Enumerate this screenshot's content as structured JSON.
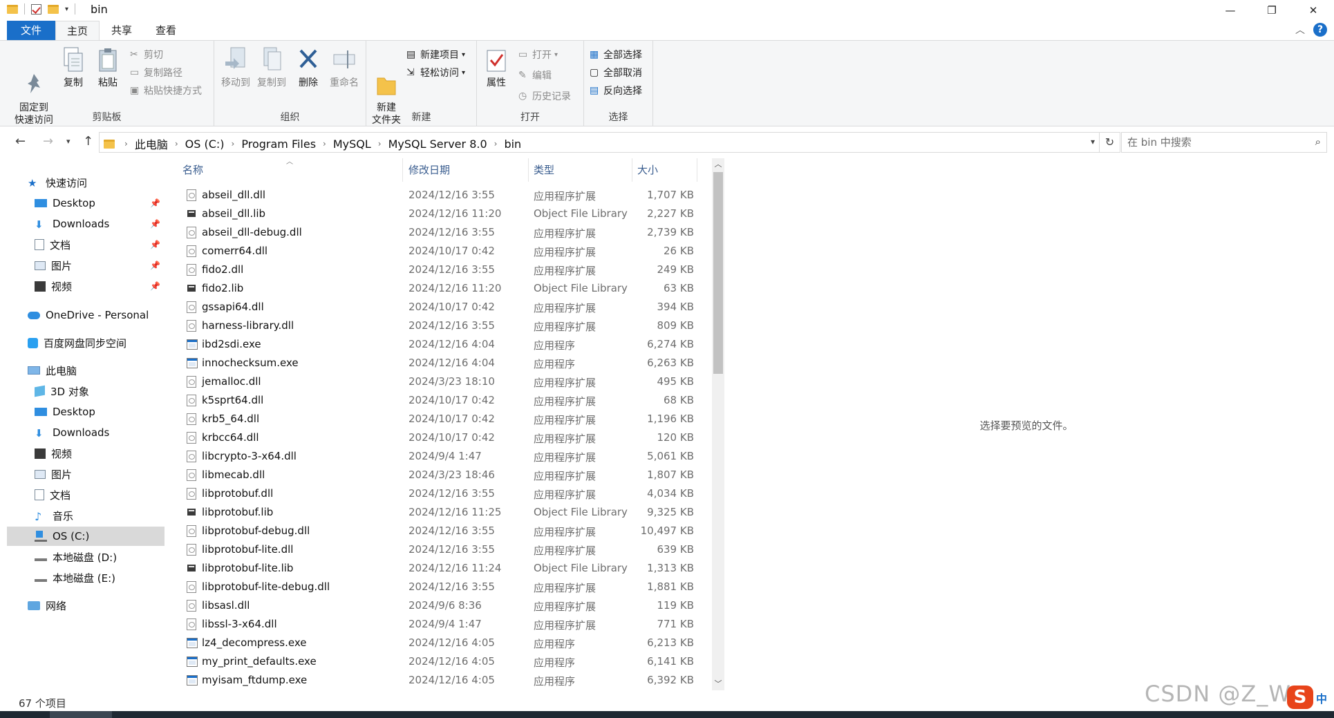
{
  "window": {
    "title": "bin",
    "controls": {
      "minimize": "—",
      "maximize": "❐",
      "close": "✕"
    }
  },
  "ribbon_tabs": [
    {
      "label": "文件"
    },
    {
      "label": "主页"
    },
    {
      "label": "共享"
    },
    {
      "label": "查看"
    }
  ],
  "ribbon": {
    "clipboard": {
      "label": "剪贴板",
      "pin": "固定到\n快速访问",
      "copy": "复制",
      "paste": "粘贴",
      "cut": "剪切",
      "copy_path": "复制路径",
      "paste_shortcut": "粘贴快捷方式"
    },
    "organize": {
      "label": "组织",
      "move_to": "移动到",
      "copy_to": "复制到",
      "delete": "删除",
      "rename": "重命名"
    },
    "new": {
      "label": "新建",
      "new_folder": "新建\n文件夹",
      "new_item": "新建项目",
      "easy_access": "轻松访问"
    },
    "open": {
      "label": "打开",
      "properties": "属性",
      "open": "打开",
      "edit": "编辑",
      "history": "历史记录"
    },
    "select": {
      "label": "选择",
      "select_all": "全部选择",
      "select_none": "全部取消",
      "invert": "反向选择"
    }
  },
  "address": {
    "crumbs": [
      "此电脑",
      "OS (C:)",
      "Program Files",
      "MySQL",
      "MySQL Server 8.0",
      "bin"
    ],
    "search_placeholder": "在 bin 中搜索"
  },
  "nav_pane": {
    "quick_access": "快速访问",
    "quick_items": [
      "Desktop",
      "Downloads",
      "文档",
      "图片",
      "视频"
    ],
    "onedrive": "OneDrive - Personal",
    "baidu": "百度网盘同步空间",
    "this_pc": "此电脑",
    "pc_items": [
      "3D 对象",
      "Desktop",
      "Downloads",
      "视频",
      "图片",
      "文档",
      "音乐",
      "OS (C:)",
      "本地磁盘 (D:)",
      "本地磁盘 (E:)"
    ],
    "network": "网络"
  },
  "columns": {
    "name": "名称",
    "date": "修改日期",
    "type": "类型",
    "size": "大小"
  },
  "files": [
    {
      "name": "abseil_dll.dll",
      "date": "2024/12/16 3:55",
      "type": "应用程序扩展",
      "size": "1,707 KB",
      "icon": "dll"
    },
    {
      "name": "abseil_dll.lib",
      "date": "2024/12/16 11:20",
      "type": "Object File Library",
      "size": "2,227 KB",
      "icon": "lib"
    },
    {
      "name": "abseil_dll-debug.dll",
      "date": "2024/12/16 3:55",
      "type": "应用程序扩展",
      "size": "2,739 KB",
      "icon": "dll"
    },
    {
      "name": "comerr64.dll",
      "date": "2024/10/17 0:42",
      "type": "应用程序扩展",
      "size": "26 KB",
      "icon": "dll"
    },
    {
      "name": "fido2.dll",
      "date": "2024/12/16 3:55",
      "type": "应用程序扩展",
      "size": "249 KB",
      "icon": "dll"
    },
    {
      "name": "fido2.lib",
      "date": "2024/12/16 11:20",
      "type": "Object File Library",
      "size": "63 KB",
      "icon": "lib"
    },
    {
      "name": "gssapi64.dll",
      "date": "2024/10/17 0:42",
      "type": "应用程序扩展",
      "size": "394 KB",
      "icon": "dll"
    },
    {
      "name": "harness-library.dll",
      "date": "2024/12/16 3:55",
      "type": "应用程序扩展",
      "size": "809 KB",
      "icon": "dll"
    },
    {
      "name": "ibd2sdi.exe",
      "date": "2024/12/16 4:04",
      "type": "应用程序",
      "size": "6,274 KB",
      "icon": "exe"
    },
    {
      "name": "innochecksum.exe",
      "date": "2024/12/16 4:04",
      "type": "应用程序",
      "size": "6,263 KB",
      "icon": "exe"
    },
    {
      "name": "jemalloc.dll",
      "date": "2024/3/23 18:10",
      "type": "应用程序扩展",
      "size": "495 KB",
      "icon": "dll"
    },
    {
      "name": "k5sprt64.dll",
      "date": "2024/10/17 0:42",
      "type": "应用程序扩展",
      "size": "68 KB",
      "icon": "dll"
    },
    {
      "name": "krb5_64.dll",
      "date": "2024/10/17 0:42",
      "type": "应用程序扩展",
      "size": "1,196 KB",
      "icon": "dll"
    },
    {
      "name": "krbcc64.dll",
      "date": "2024/10/17 0:42",
      "type": "应用程序扩展",
      "size": "120 KB",
      "icon": "dll"
    },
    {
      "name": "libcrypto-3-x64.dll",
      "date": "2024/9/4 1:47",
      "type": "应用程序扩展",
      "size": "5,061 KB",
      "icon": "dll"
    },
    {
      "name": "libmecab.dll",
      "date": "2024/3/23 18:46",
      "type": "应用程序扩展",
      "size": "1,807 KB",
      "icon": "dll"
    },
    {
      "name": "libprotobuf.dll",
      "date": "2024/12/16 3:55",
      "type": "应用程序扩展",
      "size": "4,034 KB",
      "icon": "dll"
    },
    {
      "name": "libprotobuf.lib",
      "date": "2024/12/16 11:25",
      "type": "Object File Library",
      "size": "9,325 KB",
      "icon": "lib"
    },
    {
      "name": "libprotobuf-debug.dll",
      "date": "2024/12/16 3:55",
      "type": "应用程序扩展",
      "size": "10,497 KB",
      "icon": "dll"
    },
    {
      "name": "libprotobuf-lite.dll",
      "date": "2024/12/16 3:55",
      "type": "应用程序扩展",
      "size": "639 KB",
      "icon": "dll"
    },
    {
      "name": "libprotobuf-lite.lib",
      "date": "2024/12/16 11:24",
      "type": "Object File Library",
      "size": "1,313 KB",
      "icon": "lib"
    },
    {
      "name": "libprotobuf-lite-debug.dll",
      "date": "2024/12/16 3:55",
      "type": "应用程序扩展",
      "size": "1,881 KB",
      "icon": "dll"
    },
    {
      "name": "libsasl.dll",
      "date": "2024/9/6 8:36",
      "type": "应用程序扩展",
      "size": "119 KB",
      "icon": "dll"
    },
    {
      "name": "libssl-3-x64.dll",
      "date": "2024/9/4 1:47",
      "type": "应用程序扩展",
      "size": "771 KB",
      "icon": "dll"
    },
    {
      "name": "lz4_decompress.exe",
      "date": "2024/12/16 4:05",
      "type": "应用程序",
      "size": "6,213 KB",
      "icon": "exe"
    },
    {
      "name": "my_print_defaults.exe",
      "date": "2024/12/16 4:05",
      "type": "应用程序",
      "size": "6,141 KB",
      "icon": "exe"
    },
    {
      "name": "myisam_ftdump.exe",
      "date": "2024/12/16 4:05",
      "type": "应用程序",
      "size": "6,392 KB",
      "icon": "exe"
    }
  ],
  "preview_text": "选择要预览的文件。",
  "status_text": "67 个项目",
  "watermark": "CSDN @Z_W",
  "ime": {
    "logo": "S",
    "mode": "中"
  }
}
